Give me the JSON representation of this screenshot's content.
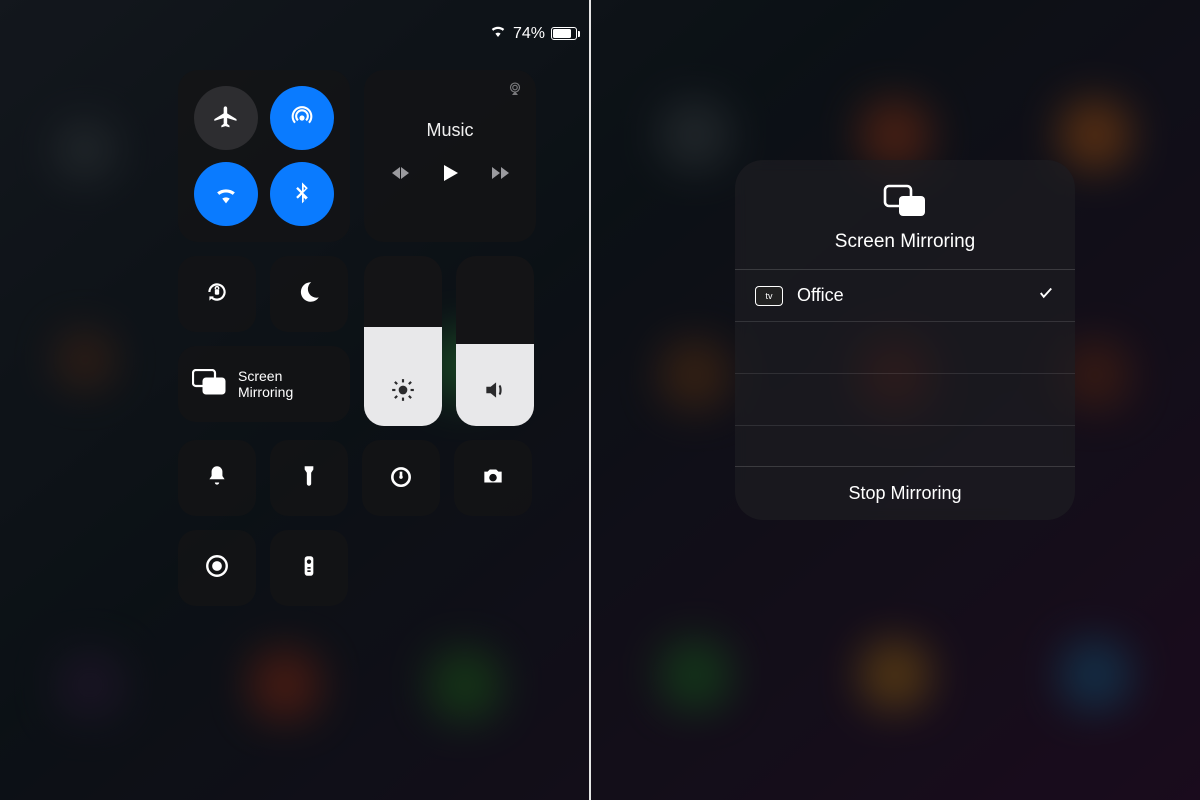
{
  "status": {
    "battery_percent": "74%"
  },
  "connectivity": {
    "airplane": {
      "on": false
    },
    "airdrop": {
      "on": true
    },
    "wifi": {
      "on": true
    },
    "bluetooth": {
      "on": true
    }
  },
  "music": {
    "label": "Music"
  },
  "sliders": {
    "brightness_pct": 58,
    "volume_pct": 48
  },
  "mirroring_tile": {
    "line1": "Screen",
    "line2": "Mirroring"
  },
  "popup": {
    "title": "Screen Mirroring",
    "devices": [
      {
        "name": "Office",
        "kind": "tv",
        "selected": true
      }
    ],
    "device_kind_label": "tv",
    "stop_label": "Stop Mirroring"
  }
}
